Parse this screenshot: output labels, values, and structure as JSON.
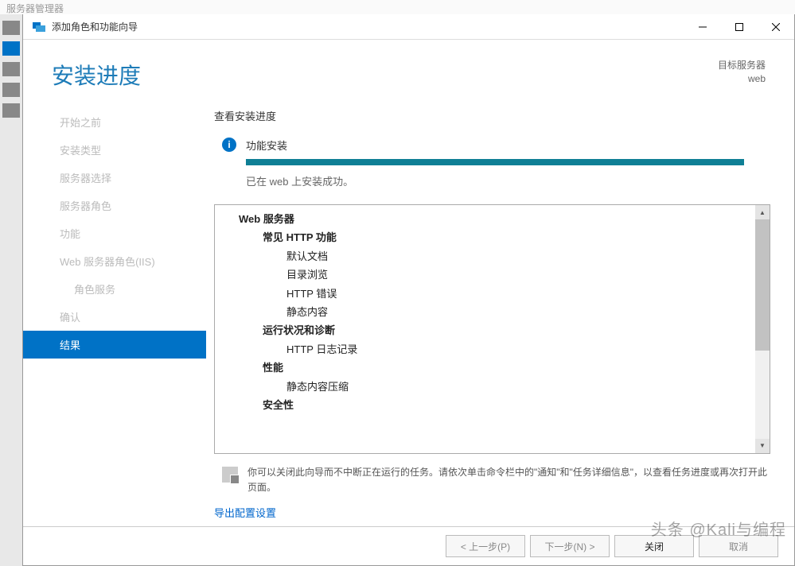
{
  "parent_window_title": "服务器管理器",
  "dialog": {
    "title": "添加角色和功能向导",
    "target_label": "目标服务器",
    "target_name": "web"
  },
  "page_title": "安装进度",
  "nav": [
    {
      "label": "开始之前",
      "active": false,
      "sub": false
    },
    {
      "label": "安装类型",
      "active": false,
      "sub": false
    },
    {
      "label": "服务器选择",
      "active": false,
      "sub": false
    },
    {
      "label": "服务器角色",
      "active": false,
      "sub": false
    },
    {
      "label": "功能",
      "active": false,
      "sub": false
    },
    {
      "label": "Web 服务器角色(IIS)",
      "active": false,
      "sub": false
    },
    {
      "label": "角色服务",
      "active": false,
      "sub": true
    },
    {
      "label": "确认",
      "active": false,
      "sub": false
    },
    {
      "label": "结果",
      "active": true,
      "sub": false
    }
  ],
  "content": {
    "heading": "查看安装进度",
    "status_label": "功能安装",
    "status_message": "已在 web 上安装成功。",
    "note": "你可以关闭此向导而不中断正在运行的任务。请依次单击命令栏中的\"通知\"和\"任务详细信息\"，以查看任务进度或再次打开此页面。",
    "export_link": "导出配置设置"
  },
  "features": [
    {
      "level": 1,
      "text": "Web 服务器"
    },
    {
      "level": 2,
      "text": "常见 HTTP 功能"
    },
    {
      "level": 3,
      "text": "默认文档"
    },
    {
      "level": 3,
      "text": "目录浏览"
    },
    {
      "level": 3,
      "text": "HTTP 错误"
    },
    {
      "level": 3,
      "text": "静态内容"
    },
    {
      "level": 2,
      "text": "运行状况和诊断"
    },
    {
      "level": 3,
      "text": "HTTP 日志记录"
    },
    {
      "level": 2,
      "text": "性能"
    },
    {
      "level": 3,
      "text": "静态内容压缩"
    },
    {
      "level": 2,
      "text": "安全性"
    }
  ],
  "buttons": {
    "prev": "< 上一步(P)",
    "next": "下一步(N) >",
    "close": "关闭",
    "cancel": "取消"
  },
  "watermark": "头条 @Kali与编程"
}
